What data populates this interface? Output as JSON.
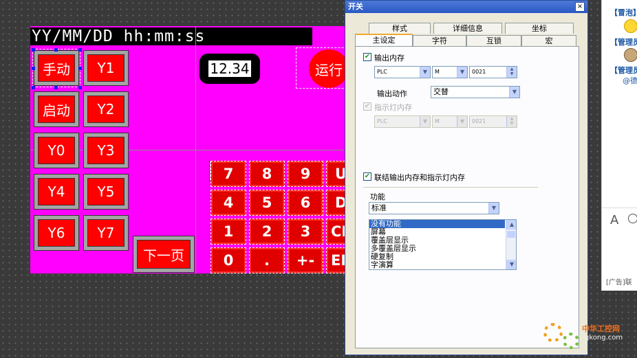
{
  "hmi": {
    "datetime": "YY/MM/DD hh:mm:ss",
    "buttons": [
      {
        "label": "手动"
      },
      {
        "label": "Y1"
      },
      {
        "label": "启动"
      },
      {
        "label": "Y2"
      },
      {
        "label": "Y0"
      },
      {
        "label": "Y3"
      },
      {
        "label": "Y4"
      },
      {
        "label": "Y5"
      },
      {
        "label": "Y6"
      },
      {
        "label": "Y7"
      }
    ],
    "next_page": "下一页",
    "numeric_display": "12.34",
    "lamp": "运行",
    "keypad": [
      "7",
      "8",
      "9",
      "UP",
      "4",
      "5",
      "6",
      "DN",
      "1",
      "2",
      "3",
      "CLR",
      "0",
      ".",
      "+-",
      "ENT"
    ],
    "keypad_icon": "0"
  },
  "dialog": {
    "title": "开关",
    "close": "×",
    "tabs_row1": [
      "样式",
      "详细信息",
      "坐标"
    ],
    "tabs_row2": [
      "主设定",
      "字符",
      "互锁",
      "宏"
    ],
    "output_memory_label": "输出内存",
    "output_device": "PLC",
    "output_type": "M",
    "output_addr": "0021",
    "output_action_label": "输出动作",
    "output_action": "交替",
    "lamp_memory_label": "指示灯内存",
    "lamp_device": "PLC",
    "lamp_type": "M",
    "lamp_addr": "0021",
    "link_label": "联结输出内存和指示灯内存",
    "function_label": "功能",
    "function_value": "标准",
    "function_list": [
      "没有功能",
      "屏幕",
      "覆盖层显示",
      "多覆盖层显示",
      "硬复制",
      "字演算"
    ]
  },
  "sidebar": {
    "lines": [
      "【冒泡】",
      "【管理员】",
      "【管理员】",
      "@德"
    ],
    "ad": "[广告]联"
  },
  "watermark": {
    "brand": "中华工控网",
    "url": "gkong.com"
  }
}
